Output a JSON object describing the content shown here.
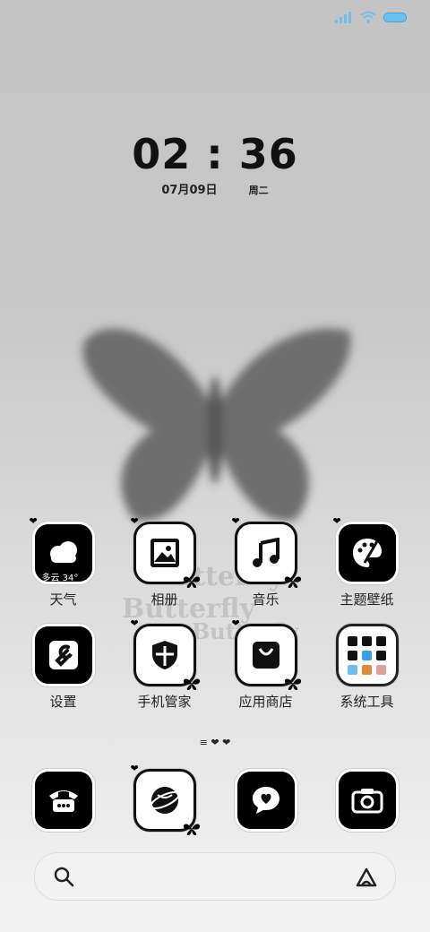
{
  "clock": {
    "time": "02 : 36",
    "date": "07月09日",
    "weekday": "周二"
  },
  "watermark": "Butterfly",
  "apps_row1": [
    {
      "label": "天气",
      "overlay": "多云 34°"
    },
    {
      "label": "相册"
    },
    {
      "label": "音乐"
    },
    {
      "label": "主题壁纸"
    }
  ],
  "apps_row2": [
    {
      "label": "设置"
    },
    {
      "label": "手机管家"
    },
    {
      "label": "应用商店"
    },
    {
      "label": "系统工具"
    }
  ],
  "page_indicator": "≡ ❤ ❤",
  "colors": {
    "accent": "#3aa2e0",
    "icon_bg": "#000000"
  }
}
